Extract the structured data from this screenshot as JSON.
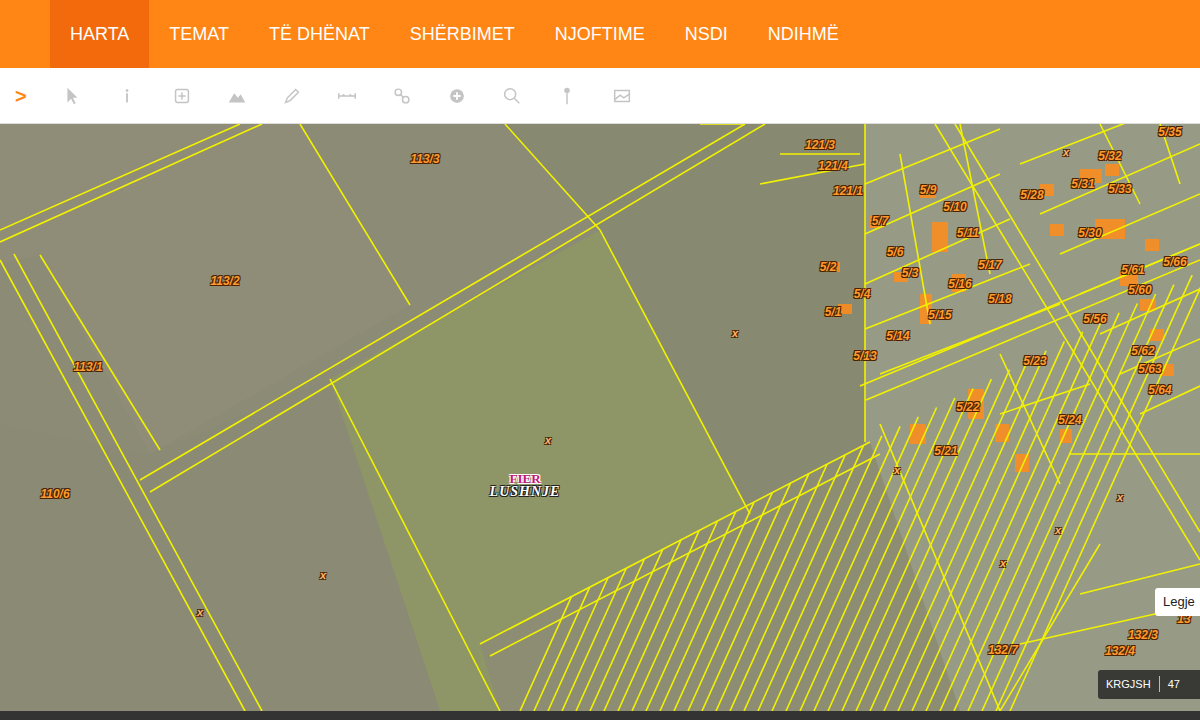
{
  "nav": {
    "items": [
      {
        "label": "HARTA",
        "selected": true
      },
      {
        "label": "TEMAT",
        "selected": false
      },
      {
        "label": "TË DHËNAT",
        "selected": false
      },
      {
        "label": "SHËRBIMET",
        "selected": false
      },
      {
        "label": "NJOFTIME",
        "selected": false
      },
      {
        "label": "NSDI",
        "selected": false
      },
      {
        "label": "NDIHMË",
        "selected": false
      }
    ]
  },
  "toolbar": {
    "toggle": ">"
  },
  "map": {
    "labels": [
      {
        "text": "113/3",
        "kind": "parcel"
      },
      {
        "text": "113/2",
        "kind": "parcel"
      },
      {
        "text": "113/1",
        "kind": "parcel"
      },
      {
        "text": "110/6",
        "kind": "parcel"
      },
      {
        "text": "121/3",
        "kind": "parcel"
      },
      {
        "text": "121/4",
        "kind": "parcel"
      },
      {
        "text": "121/1",
        "kind": "parcel"
      },
      {
        "text": "5/9",
        "kind": "parcel"
      },
      {
        "text": "5/7",
        "kind": "parcel"
      },
      {
        "text": "5/10",
        "kind": "parcel"
      },
      {
        "text": "5/6",
        "kind": "parcel"
      },
      {
        "text": "5/11",
        "kind": "parcel"
      },
      {
        "text": "5/2",
        "kind": "parcel"
      },
      {
        "text": "5/3",
        "kind": "parcel"
      },
      {
        "text": "5/4",
        "kind": "parcel"
      },
      {
        "text": "5/16",
        "kind": "parcel"
      },
      {
        "text": "5/17",
        "kind": "parcel"
      },
      {
        "text": "5/1",
        "kind": "parcel"
      },
      {
        "text": "5/15",
        "kind": "parcel"
      },
      {
        "text": "5/18",
        "kind": "parcel"
      },
      {
        "text": "5/13",
        "kind": "parcel"
      },
      {
        "text": "5/14",
        "kind": "parcel"
      },
      {
        "text": "5/23",
        "kind": "parcel"
      },
      {
        "text": "5/22",
        "kind": "parcel"
      },
      {
        "text": "5/24",
        "kind": "parcel"
      },
      {
        "text": "5/21",
        "kind": "parcel"
      },
      {
        "text": "5/28",
        "kind": "parcel"
      },
      {
        "text": "5/31",
        "kind": "parcel"
      },
      {
        "text": "5/32",
        "kind": "parcel"
      },
      {
        "text": "5/33",
        "kind": "parcel"
      },
      {
        "text": "5/35",
        "kind": "parcel"
      },
      {
        "text": "5/30",
        "kind": "parcel"
      },
      {
        "text": "5/66",
        "kind": "parcel"
      },
      {
        "text": "5/61",
        "kind": "parcel"
      },
      {
        "text": "5/60",
        "kind": "parcel"
      },
      {
        "text": "5/56",
        "kind": "parcel"
      },
      {
        "text": "5/62",
        "kind": "parcel"
      },
      {
        "text": "5/63",
        "kind": "parcel"
      },
      {
        "text": "5/64",
        "kind": "parcel"
      },
      {
        "text": "132/7",
        "kind": "parcel"
      },
      {
        "text": "132/4",
        "kind": "parcel"
      },
      {
        "text": "132/3",
        "kind": "parcel"
      },
      {
        "text": "13",
        "kind": "parcel"
      },
      {
        "text": "x",
        "kind": "marker"
      },
      {
        "text": "x",
        "kind": "marker"
      },
      {
        "text": "x",
        "kind": "marker"
      },
      {
        "text": "x",
        "kind": "marker"
      },
      {
        "text": "x",
        "kind": "marker"
      },
      {
        "text": "x",
        "kind": "marker"
      },
      {
        "text": "x",
        "kind": "marker"
      },
      {
        "text": "x",
        "kind": "marker"
      },
      {
        "text": "x",
        "kind": "marker"
      }
    ],
    "place": {
      "region": "FIER",
      "name": "LUSHNJE"
    },
    "legend_tab": "Legje",
    "scale": {
      "projection": "KRGJSH",
      "reading": "47"
    }
  }
}
